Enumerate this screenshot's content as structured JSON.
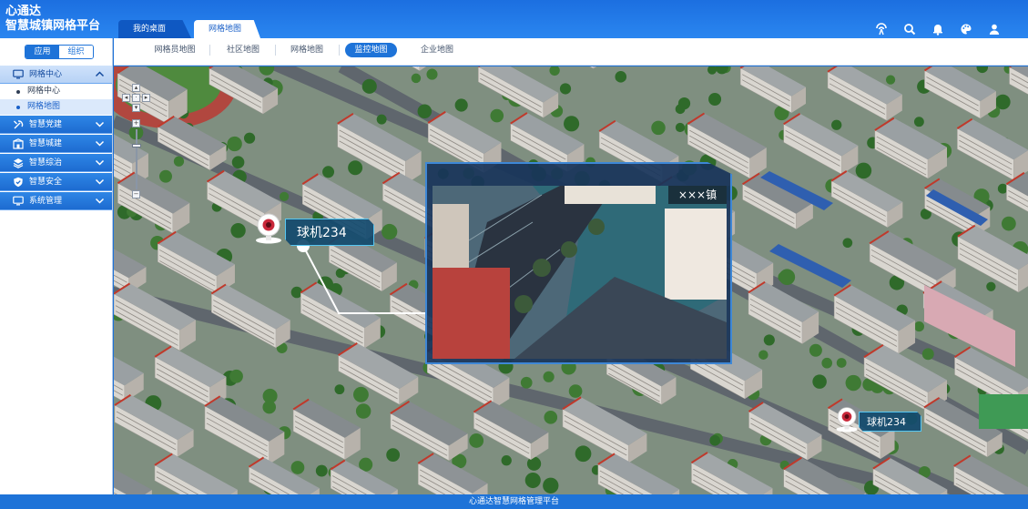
{
  "brand": {
    "line1": "心通达",
    "line2": "智慧城镇网格平台"
  },
  "top_tabs": [
    {
      "label": "我的桌面"
    },
    {
      "label": "网格地图"
    }
  ],
  "header_icons": [
    "broadcast-icon",
    "search-icon",
    "bell-icon",
    "palette-icon",
    "user-icon"
  ],
  "sidebar": {
    "switch": {
      "on": "应用",
      "off": "组织"
    },
    "groups": [
      {
        "label": "网格中心",
        "icon": "monitor-icon",
        "open": true,
        "children": [
          {
            "label": "网格中心"
          },
          {
            "label": "网格地图",
            "active": true
          }
        ]
      },
      {
        "label": "智慧党建",
        "icon": "party-icon"
      },
      {
        "label": "智慧城建",
        "icon": "building-icon"
      },
      {
        "label": "智慧综治",
        "icon": "layers-icon"
      },
      {
        "label": "智慧安全",
        "icon": "shield-icon"
      },
      {
        "label": "系统管理",
        "icon": "monitor-icon"
      }
    ]
  },
  "subnav": [
    {
      "label": "网格员地图"
    },
    {
      "label": "社区地图"
    },
    {
      "label": "网格地图"
    },
    {
      "label": "监控地图",
      "active": true
    },
    {
      "label": "企业地图"
    }
  ],
  "map": {
    "cameras": [
      {
        "label": "球机234"
      },
      {
        "label": "球机234"
      }
    ],
    "video": {
      "title": "×××镇"
    }
  },
  "footer": {
    "text": "心通达智慧网格管理平台"
  },
  "colors": {
    "primary": "#1e73d8",
    "header": "#2a86f0",
    "panel": "#184d7a",
    "accent": "#56c7f2"
  }
}
